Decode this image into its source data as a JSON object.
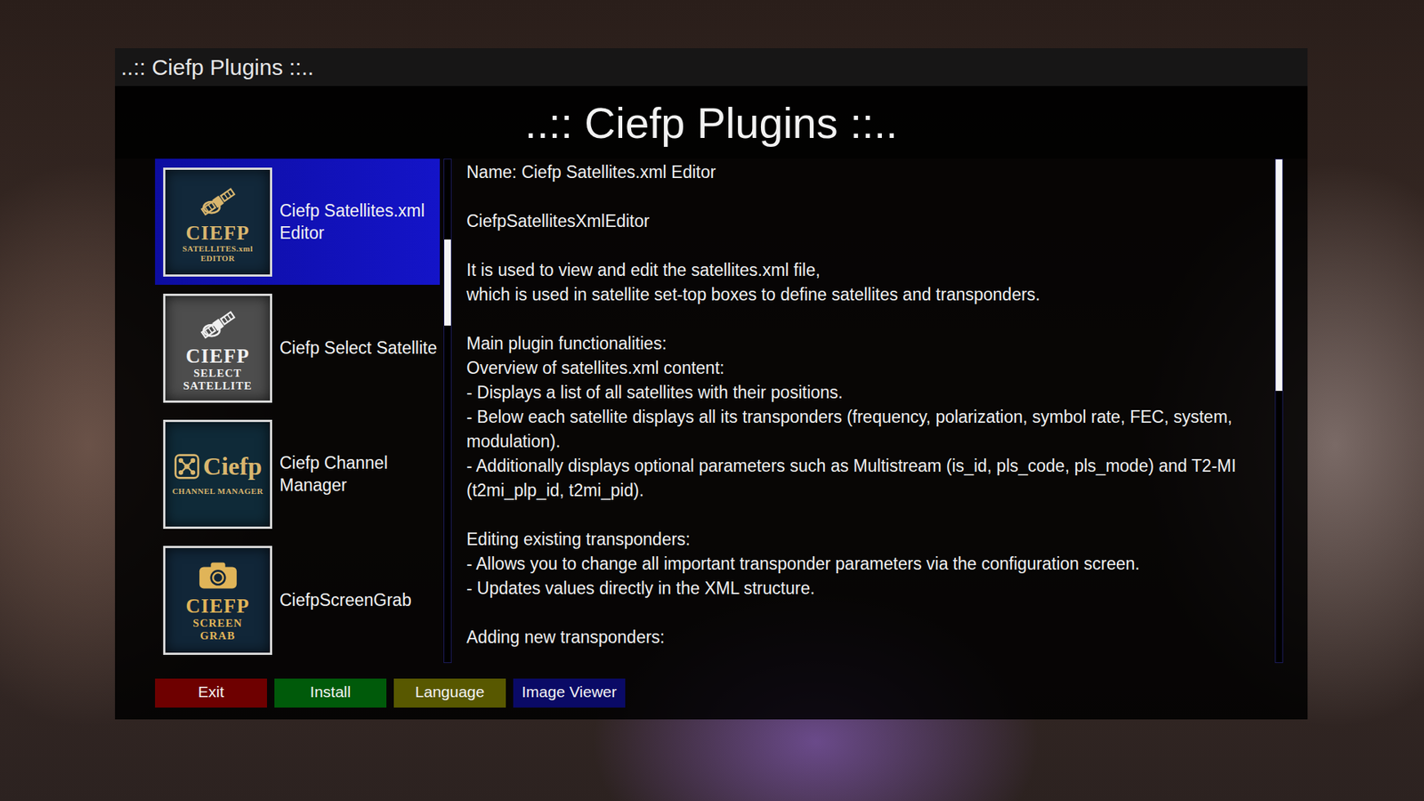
{
  "window": {
    "title": "..:: Ciefp Plugins ::.."
  },
  "heading": "..:: Ciefp Plugins ::..",
  "plugins": [
    {
      "name": "Ciefp Satellites.xml Editor",
      "selected": true,
      "kind": "satellite",
      "color": "#12283a",
      "ink": "#d9b66e",
      "logo": [
        "CIEFP",
        "SATELLITES.xml",
        "EDITOR"
      ]
    },
    {
      "name": "Ciefp Select Satellite",
      "selected": false,
      "kind": "satellite",
      "color": "#4d4d4d",
      "ink": "#f0f0f0",
      "logo": [
        "CIEFP",
        "SELECT",
        "SATELLITE"
      ]
    },
    {
      "name": "Ciefp Channel Manager",
      "selected": false,
      "kind": "network",
      "color": "#0f2a38",
      "ink": "#d9b66e",
      "logo": [
        "Ciefp",
        "CHANNEL MANAGER"
      ]
    },
    {
      "name": "CiefpScreenGrab",
      "selected": false,
      "kind": "camera",
      "color": "#112638",
      "ink": "#e0b458",
      "logo": [
        "CIEFP",
        "SCREEN",
        "GRAB"
      ]
    }
  ],
  "list_scrollbar": {
    "offset": 0.16,
    "level": 0.17
  },
  "description": {
    "paragraphs": [
      [
        "Name: Ciefp Satellites.xml Editor"
      ],
      [
        "CiefpSatellitesXmlEditor"
      ],
      [
        "It is used to view and edit the satellites.xml file,",
        "which is used in satellite set-top boxes to define satellites and transponders."
      ],
      [
        "Main plugin functionalities:",
        "Overview of satellites.xml content:",
        "- Displays a list of all satellites with their positions.",
        "- Below each satellite displays all its transponders (frequency, polarization, symbol rate, FEC, system, modulation).",
        "- Additionally displays optional parameters such as Multistream (is_id, pls_code, pls_mode) and T2-MI (t2mi_plp_id, t2mi_pid)."
      ],
      [
        "Editing existing transponders:",
        "- Allows you to change all important transponder parameters via the configuration screen.",
        "- Updates values directly in the XML structure."
      ],
      [
        "Adding new transponders:"
      ]
    ],
    "scrollbar": {
      "offset": 0,
      "level": 0.46
    }
  },
  "buttons": [
    {
      "label": "Exit",
      "color": "#6e0000"
    },
    {
      "label": "Install",
      "color": "#005a0a"
    },
    {
      "label": "Language",
      "color": "#585800"
    },
    {
      "label": "Image Viewer",
      "color": "#0a0a66"
    }
  ]
}
